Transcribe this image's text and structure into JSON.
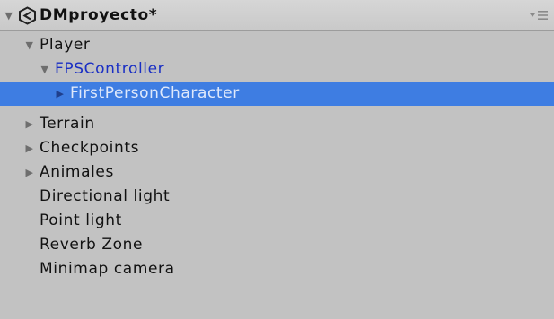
{
  "hierarchy": {
    "scene": {
      "name": "DMproyecto*",
      "expanded": true,
      "expand_icon": "triangle-down-icon",
      "icon": "unity-scene-icon"
    },
    "options_icon": "dropdown-menu-icon",
    "items": [
      {
        "label": "Player",
        "expanded": true,
        "has_children": true,
        "style": "normal"
      },
      {
        "label": "FPSController",
        "expanded": true,
        "has_children": true,
        "style": "prefab-blue"
      },
      {
        "label": "FirstPersonCharacter",
        "expanded": false,
        "has_children": true,
        "style": "prefab-blue",
        "selected": true
      },
      {
        "label": "Terrain",
        "expanded": false,
        "has_children": true,
        "style": "normal"
      },
      {
        "label": "Checkpoints",
        "expanded": false,
        "has_children": true,
        "style": "normal"
      },
      {
        "label": "Animales",
        "expanded": false,
        "has_children": true,
        "style": "normal"
      },
      {
        "label": "Directional light",
        "has_children": false,
        "style": "normal"
      },
      {
        "label": "Point light",
        "has_children": false,
        "style": "normal"
      },
      {
        "label": "Reverb Zone",
        "has_children": false,
        "style": "normal"
      },
      {
        "label": "Minimap camera",
        "has_children": false,
        "style": "normal"
      }
    ]
  },
  "colors": {
    "panel_bg": "#c2c2c2",
    "selection_bg": "#3e7de2",
    "prefab_text": "#1a2fc4",
    "text": "#111111"
  }
}
